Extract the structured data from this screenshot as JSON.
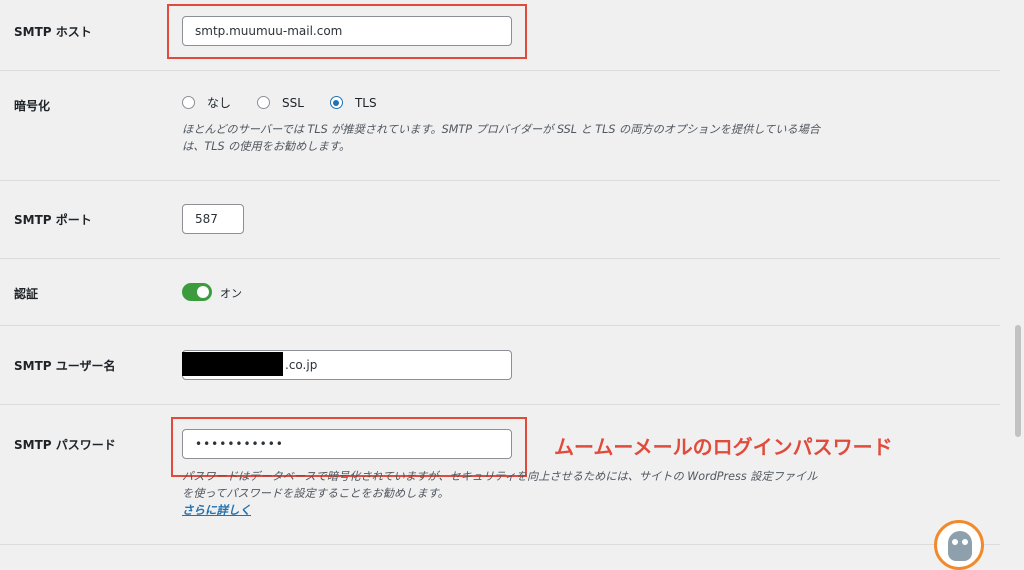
{
  "fields": {
    "smtp_host": {
      "label": "SMTP ホスト",
      "value": "smtp.muumuu-mail.com"
    },
    "encryption": {
      "label": "暗号化",
      "options": [
        "なし",
        "SSL",
        "TLS"
      ],
      "selected": "TLS",
      "description_line1": "ほとんどのサーバーでは TLS が推奨されています。SMTP プロバイダーが SSL と TLS の両方のオプションを提供している場合",
      "description_line2": "は、TLS の使用をお勧めします。"
    },
    "smtp_port": {
      "label": "SMTP ポート",
      "value": "587"
    },
    "auth": {
      "label": "認証",
      "state_text": "オン",
      "enabled": true
    },
    "smtp_username": {
      "label": "SMTP ユーザー名",
      "value_suffix": ".co.jp"
    },
    "smtp_password": {
      "label": "SMTP パスワード",
      "value": "•••••••••••",
      "description_line1": "パスワードはデータベースで暗号化されていますが、セキュリティを向上させるためには、サイトの WordPress 設定ファイル",
      "description_line2": "を使ってパスワードを設定することをお勧めします。",
      "link": "さらに詳しく"
    }
  },
  "annotation": {
    "text": "ムームーメールのログインパスワード",
    "color": "#e04b3b"
  },
  "colors": {
    "accent": "#2271b1",
    "toggle_on": "#3c9b3c"
  }
}
